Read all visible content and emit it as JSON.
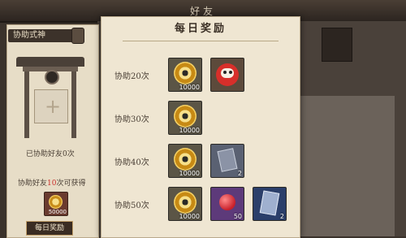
{
  "window": {
    "title": "好友"
  },
  "left_panel": {
    "assist_tag": "协助式神",
    "assisted_text": "已协助好友0次",
    "reward_hint_prefix": "协助好友",
    "reward_hint_count": "10",
    "reward_hint_suffix": "次可获得",
    "reward_item": {
      "icon": "coin-icon",
      "count": "50000"
    },
    "daily_button": "每日奖励"
  },
  "popup": {
    "title": "每日奖励",
    "rows": [
      {
        "label": "协助20次",
        "items": [
          {
            "icon": "coin-icon",
            "count": "10000"
          },
          {
            "icon": "daruma-icon",
            "count": ""
          }
        ]
      },
      {
        "label": "协助30次",
        "items": [
          {
            "icon": "coin-icon",
            "count": "10000"
          }
        ]
      },
      {
        "label": "协助40次",
        "items": [
          {
            "icon": "coin-icon",
            "count": "10000"
          },
          {
            "icon": "grey-scroll-icon",
            "count": "2"
          }
        ]
      },
      {
        "label": "协助50次",
        "items": [
          {
            "icon": "coin-icon",
            "count": "10000"
          },
          {
            "icon": "red-gem-icon",
            "count": "50"
          },
          {
            "icon": "blue-scroll-icon",
            "count": "2"
          }
        ]
      }
    ]
  },
  "colors": {
    "popup_bg": "#efe6d2",
    "highlight": "#c9302c",
    "panel_dark": "#3a322b"
  }
}
